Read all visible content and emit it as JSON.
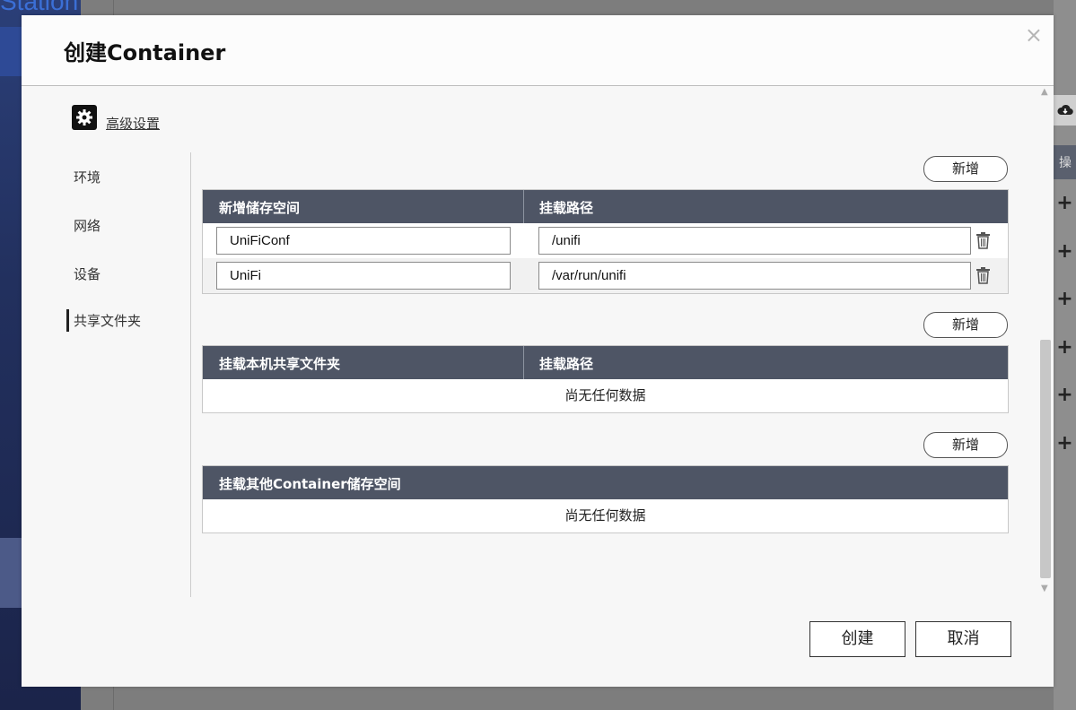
{
  "background": {
    "app_title": "Station"
  },
  "dialog": {
    "title": "创建Container",
    "close_symbol": "×",
    "advanced_label": "高级设置"
  },
  "sidebar": {
    "items": [
      {
        "label": "环境"
      },
      {
        "label": "网络"
      },
      {
        "label": "设备"
      },
      {
        "label": "共享文件夹"
      }
    ],
    "active_index": 3
  },
  "volumes": {
    "add_label": "新增",
    "columns": [
      "新增储存空间",
      "挂载路径"
    ],
    "rows": [
      {
        "name": "UniFiConf",
        "path": "/unifi"
      },
      {
        "name": "UniFi",
        "path": "/var/run/unifi"
      }
    ]
  },
  "shared_folders": {
    "add_label": "新增",
    "columns": [
      "挂载本机共享文件夹",
      "挂载路径"
    ],
    "empty_text": "尚无任何数据"
  },
  "container_volumes": {
    "add_label": "新增",
    "columns": [
      "挂载其他Container储存空间"
    ],
    "empty_text": "尚无任何数据"
  },
  "footer": {
    "create_label": "创建",
    "cancel_label": "取消"
  },
  "right_panel": {
    "header_text": "操",
    "plus_symbol": "+"
  },
  "colors": {
    "table_header": "#4e5565",
    "modal_bg": "#f7f7f7"
  },
  "icons": [
    "gear-icon",
    "trash-icon",
    "close-icon",
    "cloud-download-icon",
    "plus-icon",
    "scroll-up-icon",
    "scroll-down-icon"
  ]
}
